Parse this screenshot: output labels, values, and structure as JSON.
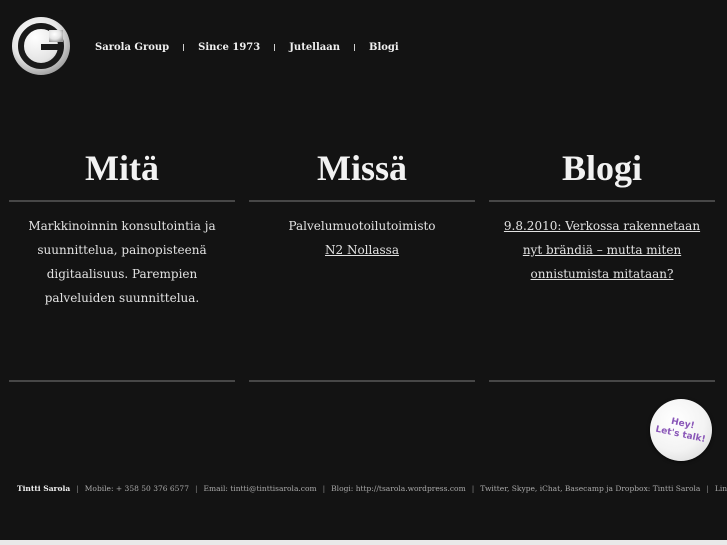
{
  "nav": {
    "items": [
      "Sarola Group",
      "Since 1973",
      "Jutellaan",
      "Blogi"
    ]
  },
  "columns": [
    {
      "title": "Mitä",
      "lines": [
        "Markkinoinnin konsultointia ja",
        "suunnittelua, painopisteenä",
        "digitaalisuus. Parempien",
        "palveluiden suunnittelua."
      ]
    },
    {
      "title": "Missä",
      "text": "Palvelumuotoilutoimisto",
      "link": "N2 Nollassa"
    },
    {
      "title": "Blogi",
      "link_lines": [
        "9.8.2010: Verkossa rakennetaan ",
        "nyt brändiä – mutta miten ",
        "onnistumista mitataan?"
      ]
    }
  ],
  "badge": {
    "text": "Hey!\nLet's talk!",
    "color": "#8a57b8"
  },
  "footer": {
    "name": "Tintti Sarola",
    "mobile": "Mobile: + 358 50 376 6577",
    "email": "Email: tintti@tinttisarola.com",
    "blog": "Blogi: http://tsarola.wordpress.com",
    "services": "Twitter, Skype, iChat, Basecamp ja Dropbox: Tintti Sarola",
    "linkedin": "LinkedIn"
  },
  "colors": {
    "background": "#131313",
    "rule": "#474747",
    "text": "#e2e2e2"
  }
}
